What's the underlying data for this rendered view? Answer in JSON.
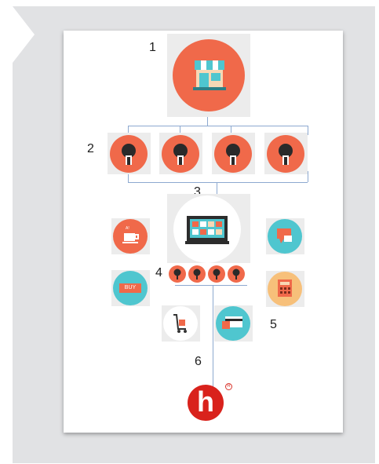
{
  "diagram": {
    "steps": [
      "1",
      "2",
      "3",
      "4",
      "5",
      "6"
    ],
    "icons": {
      "store": "store-icon",
      "users": "user-profile-icon",
      "screen": "computer-screen-icon",
      "coffee": "coffee-cup-icon",
      "buy": "buy-tag-icon",
      "chat": "chat-bubble-icon",
      "calculator": "calculator-icon",
      "cart": "hand-cart-icon",
      "card": "credit-card-icon",
      "logo": "h-logo-icon"
    },
    "buy_label": "BUY",
    "logo_letter": "h",
    "logo_mark": "R",
    "coffee_label": "A!"
  },
  "colors": {
    "orange": "#f0694a",
    "teal": "#4fc6cf",
    "connector": "#8da9d0",
    "logo_red": "#d9221c",
    "tile": "#ececec",
    "panel": "#e1e2e4"
  }
}
